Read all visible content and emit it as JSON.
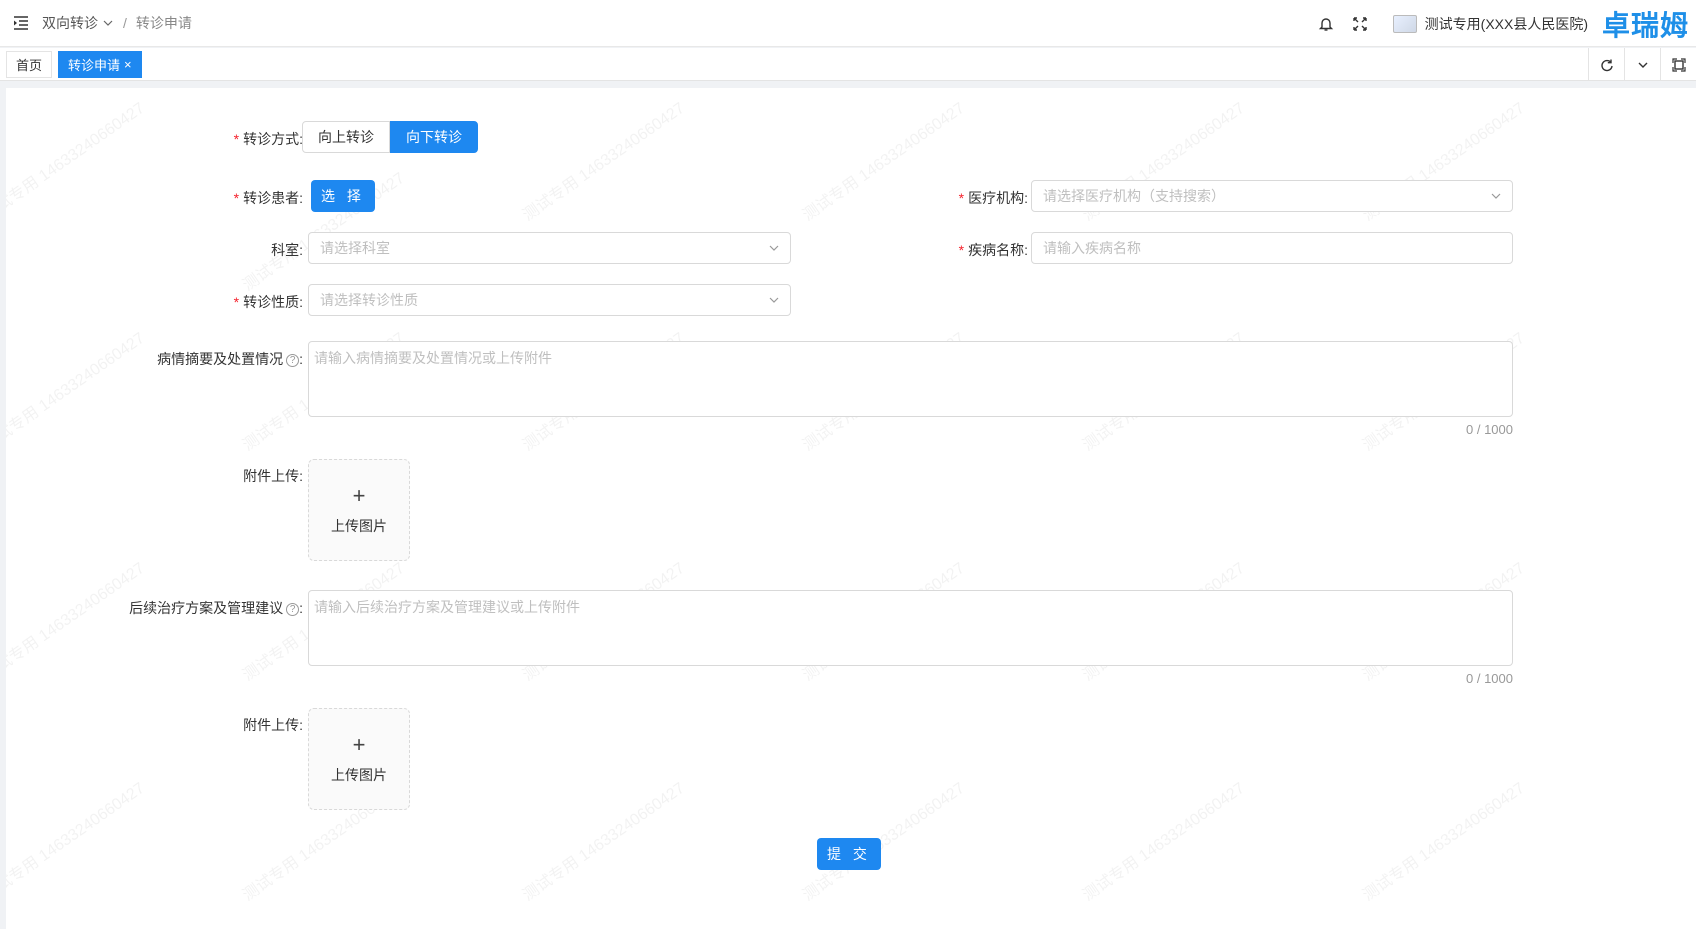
{
  "header": {
    "breadcrumb": [
      "双向转诊",
      "转诊申请"
    ],
    "hospital_name": "测试专用(XXX县人民医院)",
    "brand": "卓瑞姆"
  },
  "tabs": [
    {
      "label": "首页",
      "active": false
    },
    {
      "label": "转诊申请",
      "active": true,
      "close": "×"
    }
  ],
  "watermark": "测试专用 14633240660427",
  "form": {
    "transfer_mode": {
      "label": "转诊方式:",
      "options": [
        "向上转诊",
        "向下转诊"
      ],
      "selected": "向下转诊"
    },
    "patient": {
      "label": "转诊患者:",
      "button": "选 择"
    },
    "institution": {
      "label": "医疗机构:",
      "placeholder": "请选择医疗机构（支持搜索）"
    },
    "department": {
      "label": "科室:",
      "placeholder": "请选择科室"
    },
    "disease": {
      "label": "疾病名称:",
      "placeholder": "请输入疾病名称"
    },
    "nature": {
      "label": "转诊性质:",
      "placeholder": "请选择转诊性质"
    },
    "summary": {
      "label": "病情摘要及处置情况",
      "colon": ":",
      "placeholder": "请输入病情摘要及处置情况或上传附件",
      "counter": "0 / 1000"
    },
    "attach1": {
      "label": "附件上传:",
      "plus": "+",
      "text": "上传图片"
    },
    "plan": {
      "label": "后续治疗方案及管理建议",
      "colon": ":",
      "placeholder": "请输入后续治疗方案及管理建议或上传附件",
      "counter": "0 / 1000"
    },
    "attach2": {
      "label": "附件上传:",
      "plus": "+",
      "text": "上传图片"
    },
    "submit": "提 交",
    "required_mark": "*",
    "help_mark": "?"
  },
  "colors": {
    "primary": "#1e88f0",
    "required": "#f5222d",
    "brand": "#1e8fe8"
  }
}
